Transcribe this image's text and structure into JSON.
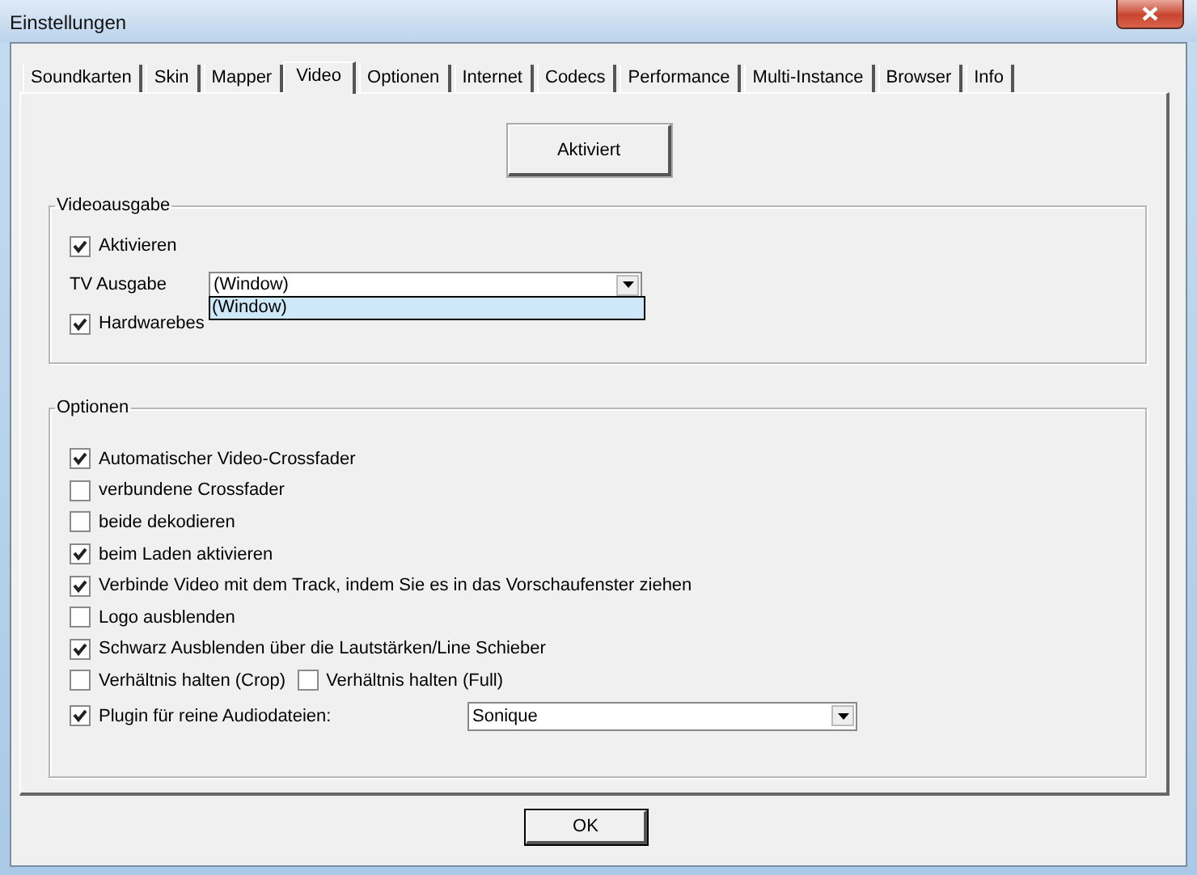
{
  "window": {
    "title": "Einstellungen"
  },
  "tabs": [
    {
      "label": "Soundkarten",
      "selected": false
    },
    {
      "label": "Skin",
      "selected": false
    },
    {
      "label": "Mapper",
      "selected": false
    },
    {
      "label": "Video",
      "selected": true
    },
    {
      "label": "Optionen",
      "selected": false
    },
    {
      "label": "Internet",
      "selected": false
    },
    {
      "label": "Codecs",
      "selected": false
    },
    {
      "label": "Performance",
      "selected": false
    },
    {
      "label": "Multi-Instance",
      "selected": false
    },
    {
      "label": "Browser",
      "selected": false
    },
    {
      "label": "Info",
      "selected": false
    }
  ],
  "activate_button": "Aktiviert",
  "video_output": {
    "title": "Videoausgabe",
    "activate": {
      "label": "Aktivieren",
      "checked": true
    },
    "tv_output": {
      "label": "TV Ausgabe",
      "value": "(Window)",
      "open": true,
      "options": [
        {
          "label": "(Window)",
          "selected": true
        }
      ]
    },
    "hardware_acceleration": {
      "label": "Hardwarebes",
      "checked": true
    }
  },
  "options": {
    "title": "Optionen",
    "items": [
      {
        "kind": "checkbox",
        "label": "Automatischer Video-Crossfader",
        "checked": true
      },
      {
        "kind": "checkbox",
        "label": "verbundene Crossfader",
        "checked": false
      },
      {
        "kind": "checkbox",
        "label": "beide dekodieren",
        "checked": false
      },
      {
        "kind": "checkbox",
        "label": "beim Laden aktivieren",
        "checked": true
      },
      {
        "kind": "checkbox",
        "label": "Verbinde Video mit dem Track, indem Sie es in das Vorschaufenster ziehen",
        "checked": true
      },
      {
        "kind": "checkbox",
        "label": "Logo ausblenden",
        "checked": false
      },
      {
        "kind": "checkbox",
        "label": "Schwarz Ausblenden über die Lautstärken/Line Schieber",
        "checked": true
      },
      {
        "kind": "pair",
        "items": [
          {
            "label": "Verhältnis halten (Crop)",
            "checked": false
          },
          {
            "label": "Verhältnis halten (Full)",
            "checked": false
          }
        ]
      },
      {
        "kind": "select",
        "label": "Plugin für reine Audiodateien:",
        "checked": true,
        "value": "Sonique"
      }
    ]
  },
  "ok_button": "OK"
}
